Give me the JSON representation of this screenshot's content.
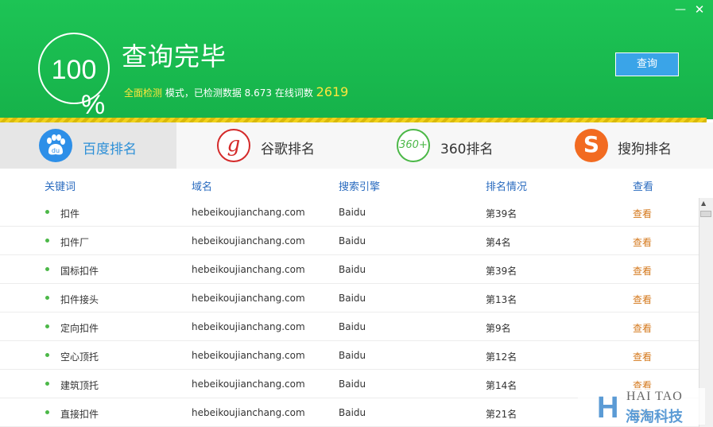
{
  "window": {
    "minimize_glyph": "—",
    "close_glyph": "✕"
  },
  "header": {
    "progress_value": "100",
    "progress_unit": "%",
    "title": "查询完毕",
    "mode_label": "全面检测",
    "stats_text": " 模式，已检测数据 8.673 在线词数 ",
    "word_count": "2619",
    "query_button": "查询"
  },
  "tabs": [
    {
      "label": "百度排名",
      "icon": "baidu-paw-icon",
      "active": true
    },
    {
      "label": "谷歌排名",
      "icon": "google-g-icon",
      "glyph": "g"
    },
    {
      "label": "360排名",
      "icon": "360-icon",
      "glyph": "360+"
    },
    {
      "label": "搜狗排名",
      "icon": "sogou-s-icon",
      "glyph": "S"
    }
  ],
  "table": {
    "headers": [
      "关键词",
      "域名",
      "搜索引擎",
      "排名情况",
      "查看"
    ],
    "rows": [
      {
        "keyword": "扣件",
        "domain": "hebeikoujianchang.com",
        "engine": "Baidu",
        "rank": "第39名",
        "action": "查看"
      },
      {
        "keyword": "扣件厂",
        "domain": "hebeikoujianchang.com",
        "engine": "Baidu",
        "rank": "第4名",
        "action": "查看"
      },
      {
        "keyword": "国标扣件",
        "domain": "hebeikoujianchang.com",
        "engine": "Baidu",
        "rank": "第39名",
        "action": "查看"
      },
      {
        "keyword": "扣件接头",
        "domain": "hebeikoujianchang.com",
        "engine": "Baidu",
        "rank": "第13名",
        "action": "查看"
      },
      {
        "keyword": "定向扣件",
        "domain": "hebeikoujianchang.com",
        "engine": "Baidu",
        "rank": "第9名",
        "action": "查看"
      },
      {
        "keyword": "空心顶托",
        "domain": "hebeikoujianchang.com",
        "engine": "Baidu",
        "rank": "第12名",
        "action": "查看"
      },
      {
        "keyword": "建筑顶托",
        "domain": "hebeikoujianchang.com",
        "engine": "Baidu",
        "rank": "第14名",
        "action": "查看"
      },
      {
        "keyword": "直接扣件",
        "domain": "hebeikoujianchang.com",
        "engine": "Baidu",
        "rank": "第21名",
        "action": "查看"
      }
    ]
  },
  "watermark": {
    "letter": "H",
    "en": "HAI TAO",
    "cn": "海淘科技"
  },
  "colors": {
    "header_green": "#1dc455",
    "accent_blue": "#2c8fd7",
    "link_orange": "#d4781c",
    "highlight_yellow": "#ffe63c"
  }
}
